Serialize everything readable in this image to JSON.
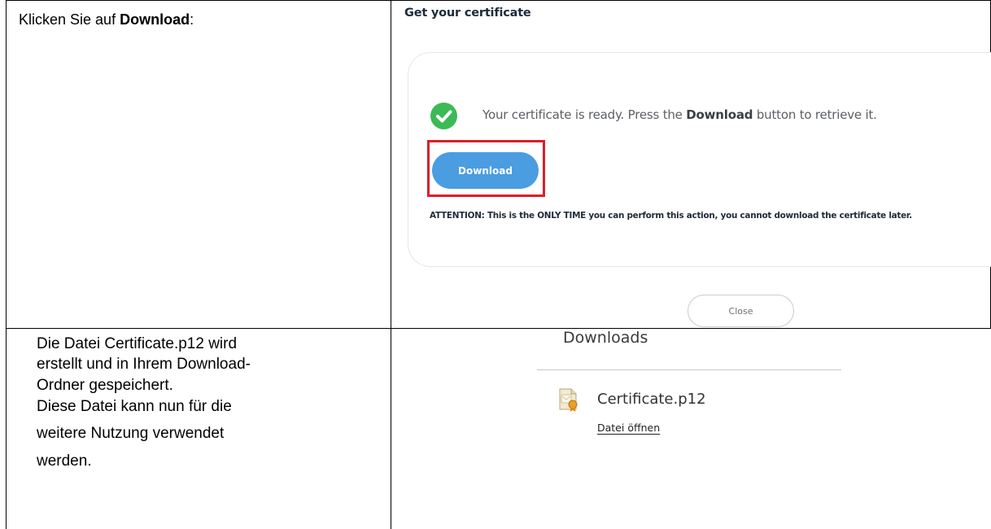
{
  "row1": {
    "instruction_prefix": "Klicken Sie auf ",
    "instruction_bold": "Download",
    "instruction_suffix": ":",
    "dialog": {
      "title": "Get your certificate",
      "status_prefix": "Your certificate is ready. Press the ",
      "status_bold": "Download",
      "status_suffix": " button to retrieve it.",
      "download_button": "Download",
      "attention": "ATTENTION: This is the ONLY TIME you can perform this action, you cannot download the certificate later.",
      "close_button": "Close",
      "colors": {
        "success": "#3cba55",
        "button": "#4a9de0",
        "highlight": "#d8202a"
      }
    }
  },
  "row2": {
    "description_lines": [
      "Die Datei Certificate.p12 wird",
      "erstellt und in Ihrem Download-",
      "Ordner gespeichert.",
      "Diese Datei kann nun für die",
      "weitere Nutzung verwendet",
      "werden."
    ],
    "downloads": {
      "heading": "Downloads",
      "file_name": "Certificate.p12",
      "open_link": "Datei öffnen",
      "file_icon": "certificate-file-icon"
    }
  }
}
